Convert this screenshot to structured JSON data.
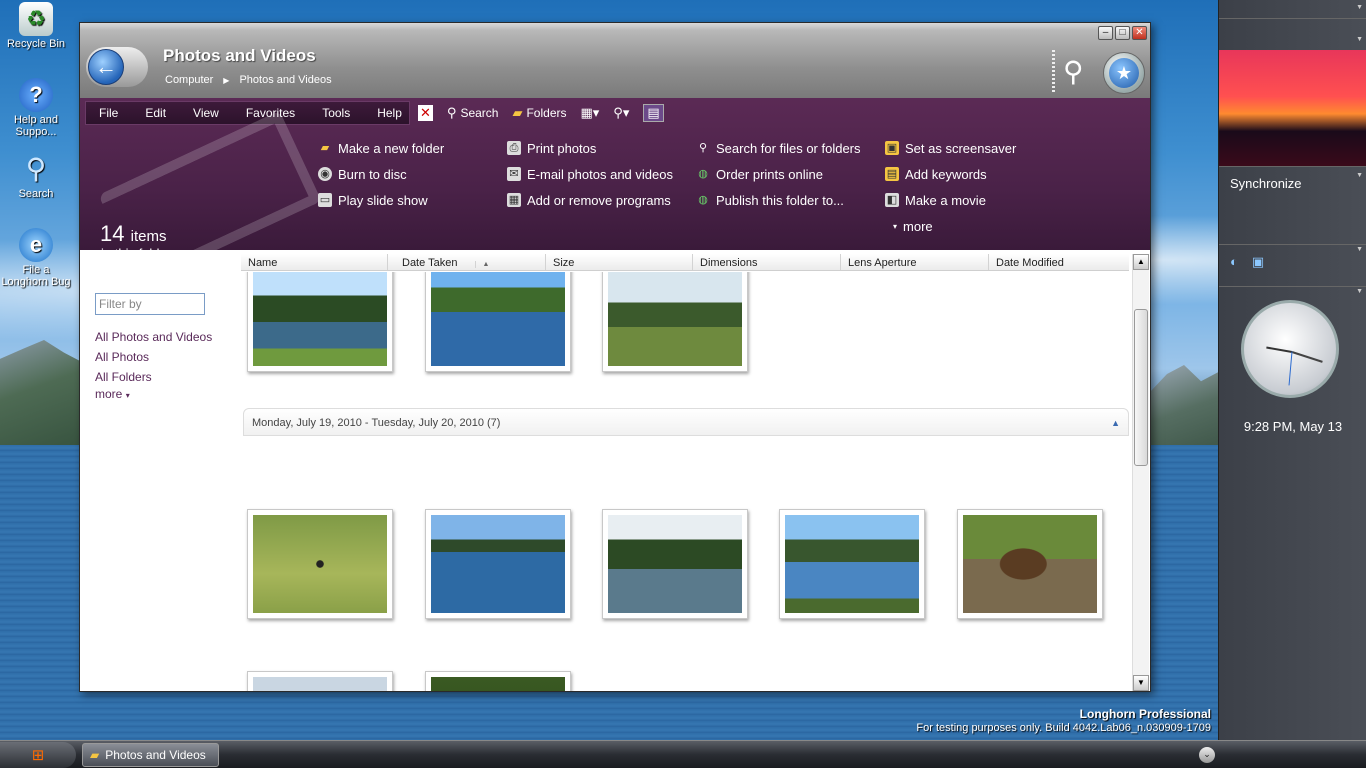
{
  "desktop": {
    "icons": [
      {
        "label": "Recycle Bin",
        "glyph": "recycle-bin-icon"
      },
      {
        "label": "Help and Suppo...",
        "glyph": "help-icon"
      },
      {
        "label": "Search",
        "glyph": "search-icon"
      },
      {
        "label": "File a Longhorn Bug",
        "glyph": "ie-bug-icon"
      }
    ],
    "watermark_title": "Longhorn Professional",
    "watermark_sub": "For testing purposes only. Build 4042.Lab06_n.030909-1709"
  },
  "window": {
    "title": "Photos and Videos",
    "breadcrumb": [
      "Computer",
      "Photos and Videos"
    ],
    "controls": {
      "minimize": "–",
      "maximize": "□",
      "close": "✕"
    }
  },
  "menu": [
    "File",
    "Edit",
    "View",
    "Favorites",
    "Tools",
    "Help"
  ],
  "toolbar": {
    "search": "Search",
    "folders": "Folders"
  },
  "folder_info": {
    "count": "14",
    "count_unit": "items",
    "sub": "in this folder"
  },
  "tasks": {
    "col1": [
      "Make a new folder",
      "Burn to disc",
      "Play slide show"
    ],
    "col2": [
      "Print photos",
      "E-mail photos and videos",
      "Add or remove programs"
    ],
    "col3": [
      "Search for files or folders",
      "Order prints online",
      "Publish this folder to..."
    ],
    "col4": [
      "Set as screensaver",
      "Add keywords",
      "Make a movie"
    ],
    "more": "more"
  },
  "columns": [
    "Name",
    "Date Taken",
    "Size",
    "Dimensions",
    "Lens Aperture",
    "Date Modified"
  ],
  "sort_indicator": "▲",
  "left_nav": {
    "filter_placeholder": "Filter by",
    "links": [
      "All Photos and Videos",
      "All Photos",
      "All Folders"
    ],
    "more": "more"
  },
  "group": {
    "label": "Monday, July 19, 2010 - Tuesday, July 20, 2010 (7)"
  },
  "sidebar": {
    "sync": "Synchronize",
    "time": "9:28 PM, May 13"
  },
  "taskbar": {
    "task_label": "Photos and Videos"
  },
  "colors": {
    "accent_purple": "#4a2248",
    "link": "#5a2a5a"
  }
}
